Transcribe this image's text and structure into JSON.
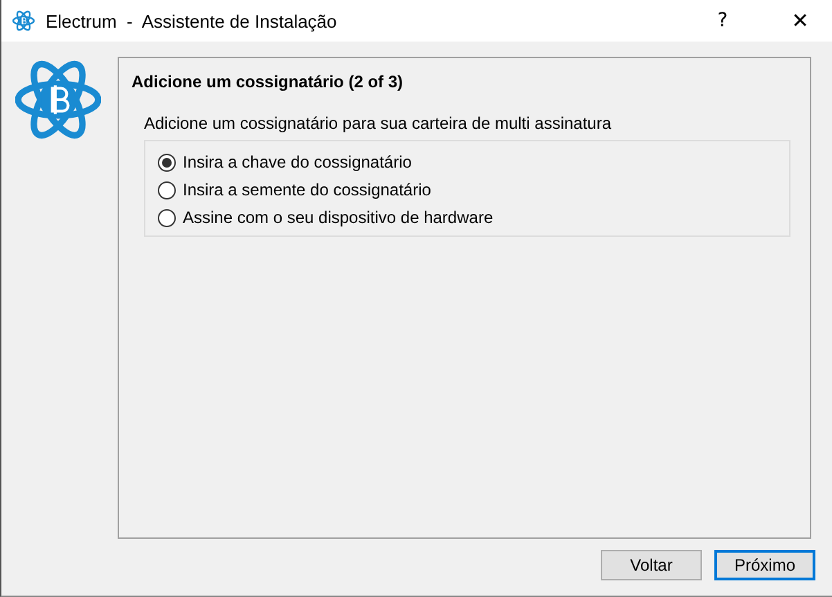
{
  "window": {
    "title": "Electrum  -  Assistente de Instalação",
    "help": "?",
    "close": "✕"
  },
  "page": {
    "heading": "Adicione um cossignatário (2 of 3)",
    "subtitle": "Adicione um cossignatário para sua carteira de multi assinatura",
    "options": [
      {
        "label": "Insira a chave do cossignatário",
        "selected": true
      },
      {
        "label": "Insira a semente do cossignatário",
        "selected": false
      },
      {
        "label": "Assine com o seu dispositivo de hardware",
        "selected": false
      }
    ]
  },
  "buttons": [
    {
      "label": "Voltar",
      "focused": false
    },
    {
      "label": "Próximo",
      "focused": true
    }
  ]
}
